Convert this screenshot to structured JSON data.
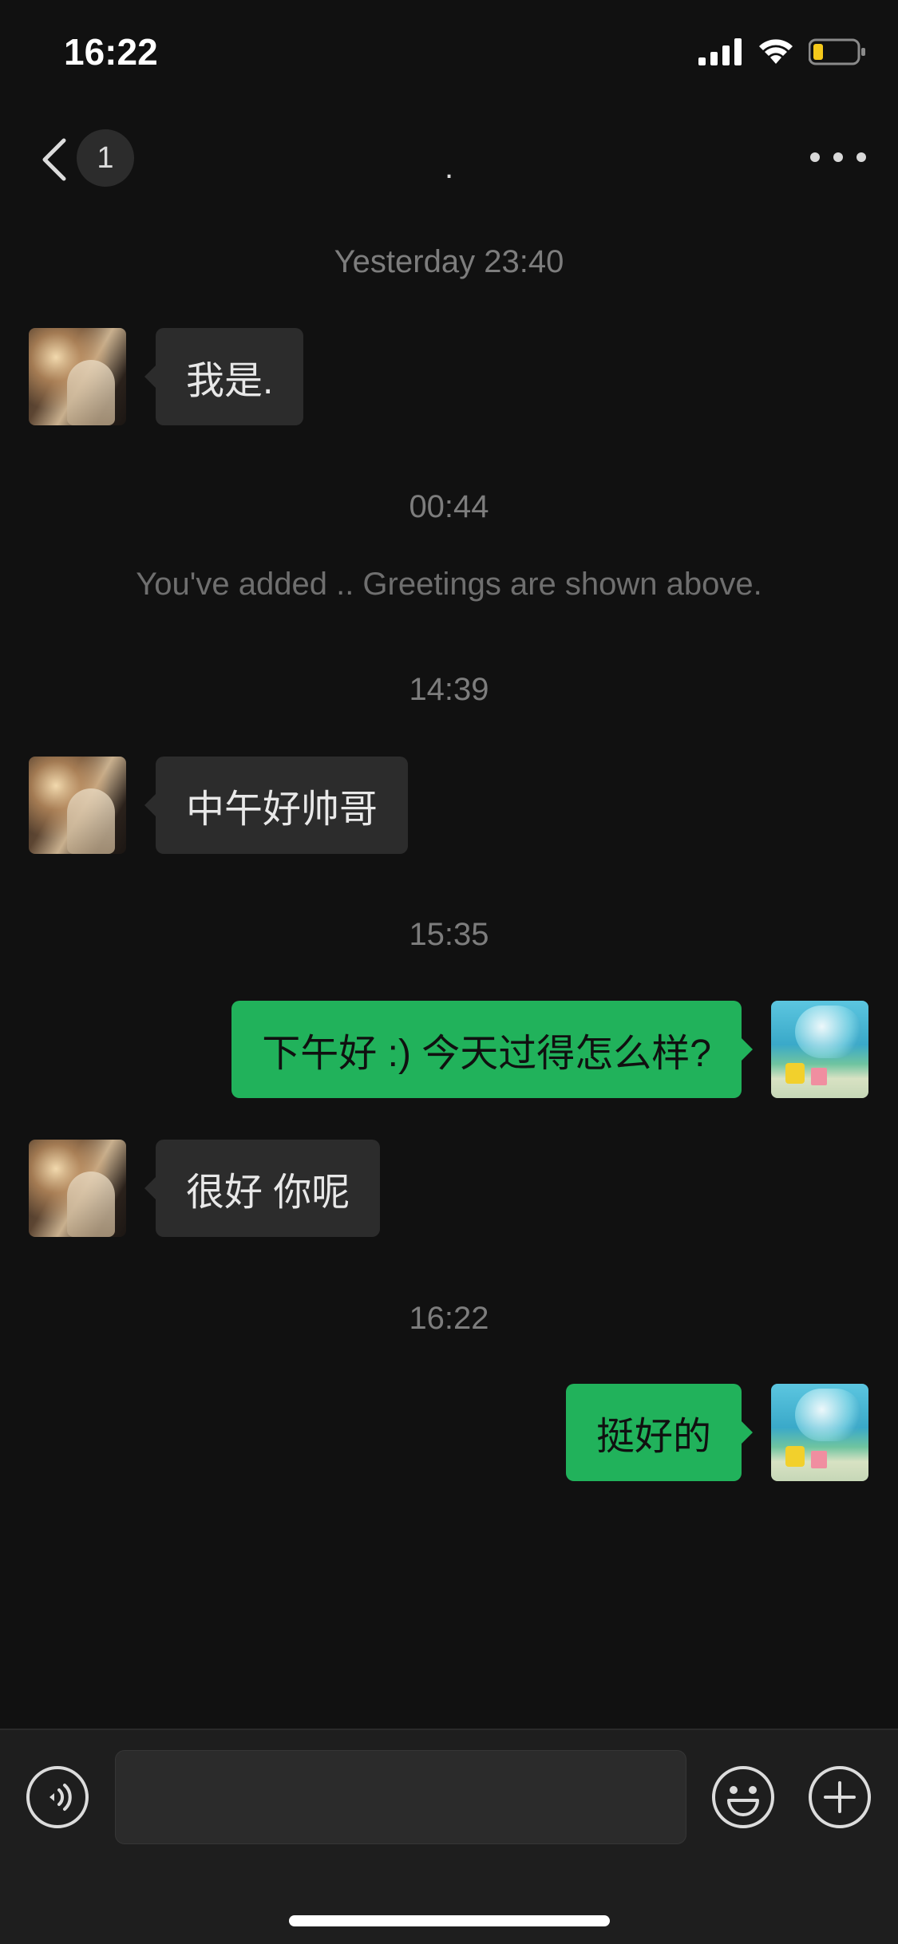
{
  "status_bar": {
    "time": "16:22"
  },
  "nav": {
    "unread_count": "1",
    "title": "."
  },
  "messages": [
    {
      "timestamp": "Yesterday 23:40"
    },
    {
      "side": "left",
      "text": "我是."
    },
    {
      "timestamp": "00:44"
    },
    {
      "system": "You've added .. Greetings are shown above."
    },
    {
      "timestamp": "14:39"
    },
    {
      "side": "left",
      "text": "中午好帅哥"
    },
    {
      "timestamp": "15:35"
    },
    {
      "side": "right",
      "text": "下午好 :) 今天过得怎么样?"
    },
    {
      "side": "left",
      "text": "很好 你呢"
    },
    {
      "timestamp": "16:22"
    },
    {
      "side": "right",
      "text": "挺好的"
    }
  ],
  "input": {
    "value": "",
    "placeholder": ""
  },
  "icons": {
    "back": "chevron-left-icon",
    "more": "more-dots-icon",
    "voice": "voice-icon",
    "emoji": "emoji-icon",
    "plus": "plus-icon"
  },
  "colors": {
    "background": "#111111",
    "incoming_bubble": "#2c2c2c",
    "outgoing_bubble": "#21b25b",
    "input_bar": "#1e1e1e"
  }
}
